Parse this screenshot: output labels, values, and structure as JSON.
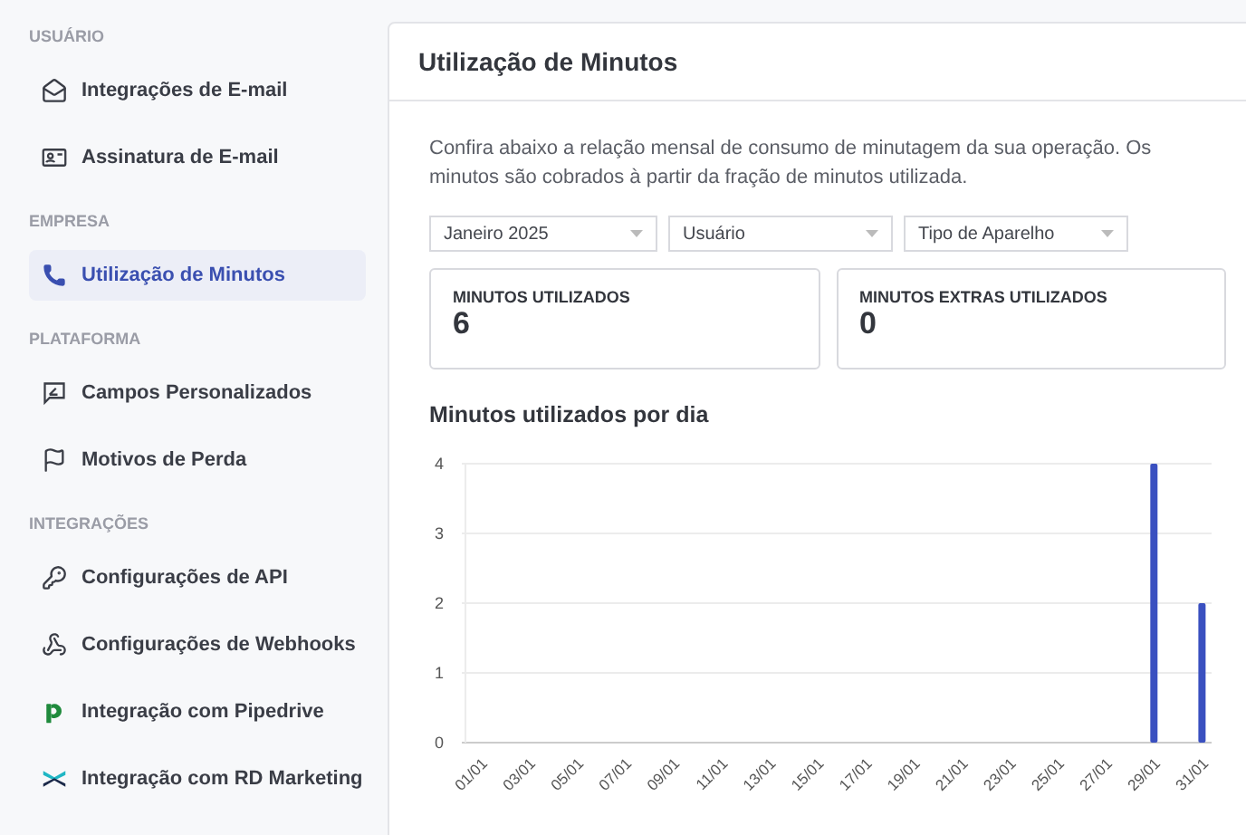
{
  "sidebar": {
    "sections": [
      {
        "heading": "USUÁRIO",
        "items": [
          {
            "label": "Integrações de E-mail",
            "selected": false
          },
          {
            "label": "Assinatura de E-mail",
            "selected": false
          }
        ]
      },
      {
        "heading": "EMPRESA",
        "items": [
          {
            "label": "Utilização de Minutos",
            "selected": true
          }
        ]
      },
      {
        "heading": "PLATAFORMA",
        "items": [
          {
            "label": "Campos Personalizados",
            "selected": false
          },
          {
            "label": "Motivos de Perda",
            "selected": false
          }
        ]
      },
      {
        "heading": "INTEGRAÇÕES",
        "items": [
          {
            "label": "Configurações de API",
            "selected": false
          },
          {
            "label": "Configurações de Webhooks",
            "selected": false
          },
          {
            "label": "Integração com Pipedrive",
            "selected": false
          },
          {
            "label": "Integração com RD Marketing",
            "selected": false
          }
        ]
      }
    ]
  },
  "card": {
    "title": "Utilização de Minutos",
    "description": "Confira abaixo a relação mensal de consumo de minutagem da sua operação. Os minutos são cobrados à partir da fração de minutos utilizada.",
    "filters": [
      {
        "value": "Janeiro 2025"
      },
      {
        "value": "Usuário"
      },
      {
        "value": "Tipo de Aparelho"
      }
    ],
    "stats": [
      {
        "label": "MINUTOS UTILIZADOS",
        "value": "6"
      },
      {
        "label": "MINUTOS EXTRAS UTILIZADOS",
        "value": "0"
      }
    ],
    "chart_title": "Minutos utilizados por dia",
    "chart_data": {
      "type": "bar",
      "categories": [
        "01/01",
        "03/01",
        "05/01",
        "07/01",
        "09/01",
        "11/01",
        "13/01",
        "15/01",
        "17/01",
        "19/01",
        "21/01",
        "23/01",
        "25/01",
        "27/01",
        "29/01",
        "31/01"
      ],
      "grid": true,
      "series": [
        {
          "color": "#3a50c0",
          "values": [
            0,
            0,
            0,
            0,
            0,
            0,
            0,
            0,
            0,
            0,
            0,
            0,
            0,
            0,
            4,
            2
          ]
        }
      ],
      "ylim": [
        0,
        4
      ],
      "yticks": [
        0,
        1,
        2,
        3,
        4
      ]
    }
  }
}
